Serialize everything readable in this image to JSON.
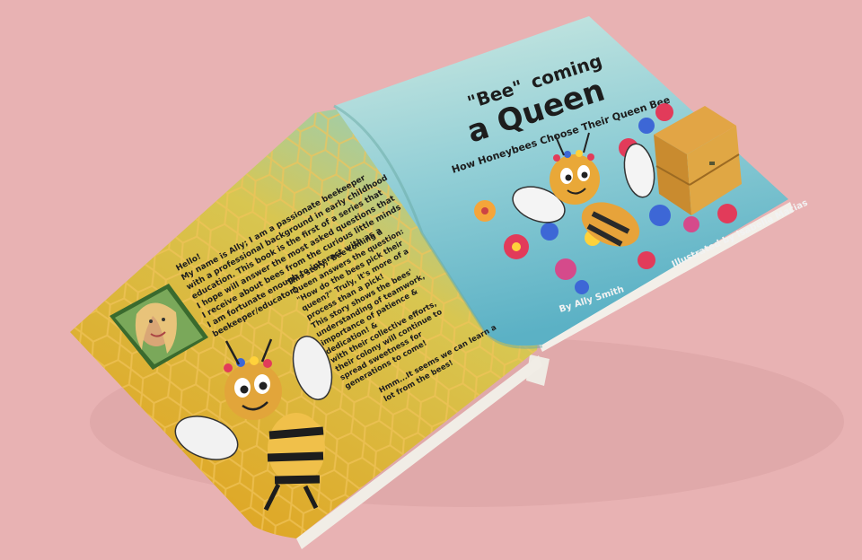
{
  "cover": {
    "title_line1_quoted": "\"Bee\"",
    "title_line1_rest": "coming",
    "title_line2": "a Queen",
    "subtitle": "How Honeybees Choose Their Queen Bee",
    "author": "By Ally Smith",
    "illustrator": "Illustrated by Isabella Macias"
  },
  "back": {
    "bio_lines": [
      "Hello!",
      "My name is Ally; I am a passionate beekeeper",
      "with a professional background in early childhood",
      "education. This book is the first of a series that",
      "I hope will answer the most asked questions that",
      "I receive about bees from the curious little minds",
      "I am fortunate enough to interact with as a",
      "beekeeper/educator!"
    ],
    "story_lines": [
      "This story, 'Bee'coming a",
      "Queen answers the question:",
      "\"How do the bees pick their",
      "queen?\" Truly, it's more of a",
      "process than a pick!",
      "This story shows the bees'",
      "understanding of teamwork,",
      "importance of patience &",
      "dedication! &",
      "with their collective efforts,",
      "their colony will continue to",
      "spread sweetness for",
      "generations to come!"
    ],
    "closing_lines": [
      "Hmm...It seems we can learn a",
      "lot from the bees!"
    ]
  },
  "colors": {
    "background": "#e8b2b3",
    "cover_top": "#c7e6df",
    "cover_bottom": "#5fb3c6",
    "back_top": "#9fd2c9",
    "back_bottom": "#e3a92a",
    "title_text": "#1d1d1d",
    "credit_text": "#f2f2f2"
  }
}
